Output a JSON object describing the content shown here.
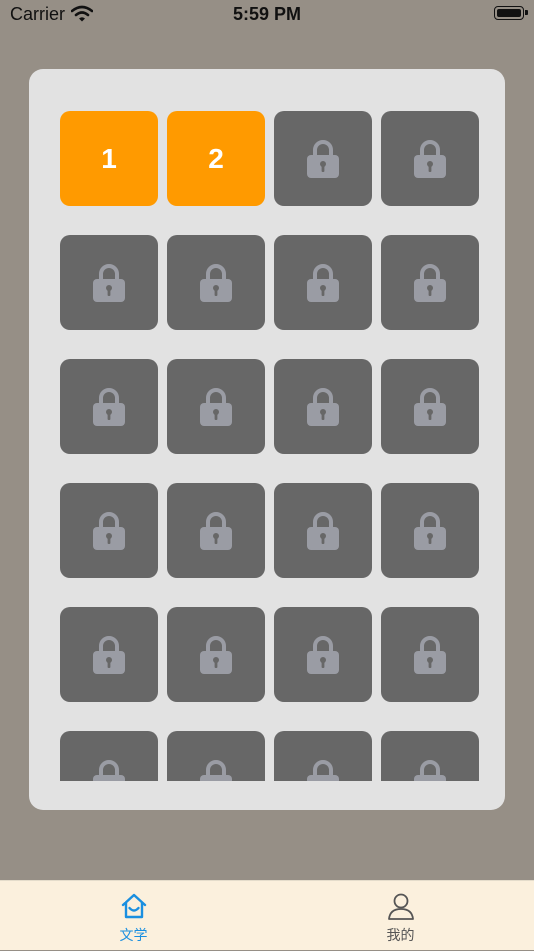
{
  "status_bar": {
    "carrier": "Carrier",
    "time": "5:59 PM"
  },
  "levels": [
    {
      "label": "1",
      "locked": false
    },
    {
      "label": "2",
      "locked": false
    },
    {
      "label": "",
      "locked": true
    },
    {
      "label": "",
      "locked": true
    },
    {
      "label": "",
      "locked": true
    },
    {
      "label": "",
      "locked": true
    },
    {
      "label": "",
      "locked": true
    },
    {
      "label": "",
      "locked": true
    },
    {
      "label": "",
      "locked": true
    },
    {
      "label": "",
      "locked": true
    },
    {
      "label": "",
      "locked": true
    },
    {
      "label": "",
      "locked": true
    },
    {
      "label": "",
      "locked": true
    },
    {
      "label": "",
      "locked": true
    },
    {
      "label": "",
      "locked": true
    },
    {
      "label": "",
      "locked": true
    },
    {
      "label": "",
      "locked": true
    },
    {
      "label": "",
      "locked": true
    },
    {
      "label": "",
      "locked": true
    },
    {
      "label": "",
      "locked": true
    },
    {
      "label": "",
      "locked": true
    },
    {
      "label": "",
      "locked": true
    },
    {
      "label": "",
      "locked": true
    },
    {
      "label": "",
      "locked": true
    }
  ],
  "colors": {
    "background": "#968f86",
    "panel": "#e2e2e2",
    "unlocked": "#ff9a00",
    "locked": "#676767",
    "lock_icon": "#9a9ca4",
    "tab_active": "#1a8fe0",
    "tab_inactive": "#555555",
    "tab_bar": "#fbf0dd"
  },
  "tabs": [
    {
      "label": "文学",
      "icon": "home-icon",
      "active": true
    },
    {
      "label": "我的",
      "icon": "person-icon",
      "active": false
    }
  ]
}
